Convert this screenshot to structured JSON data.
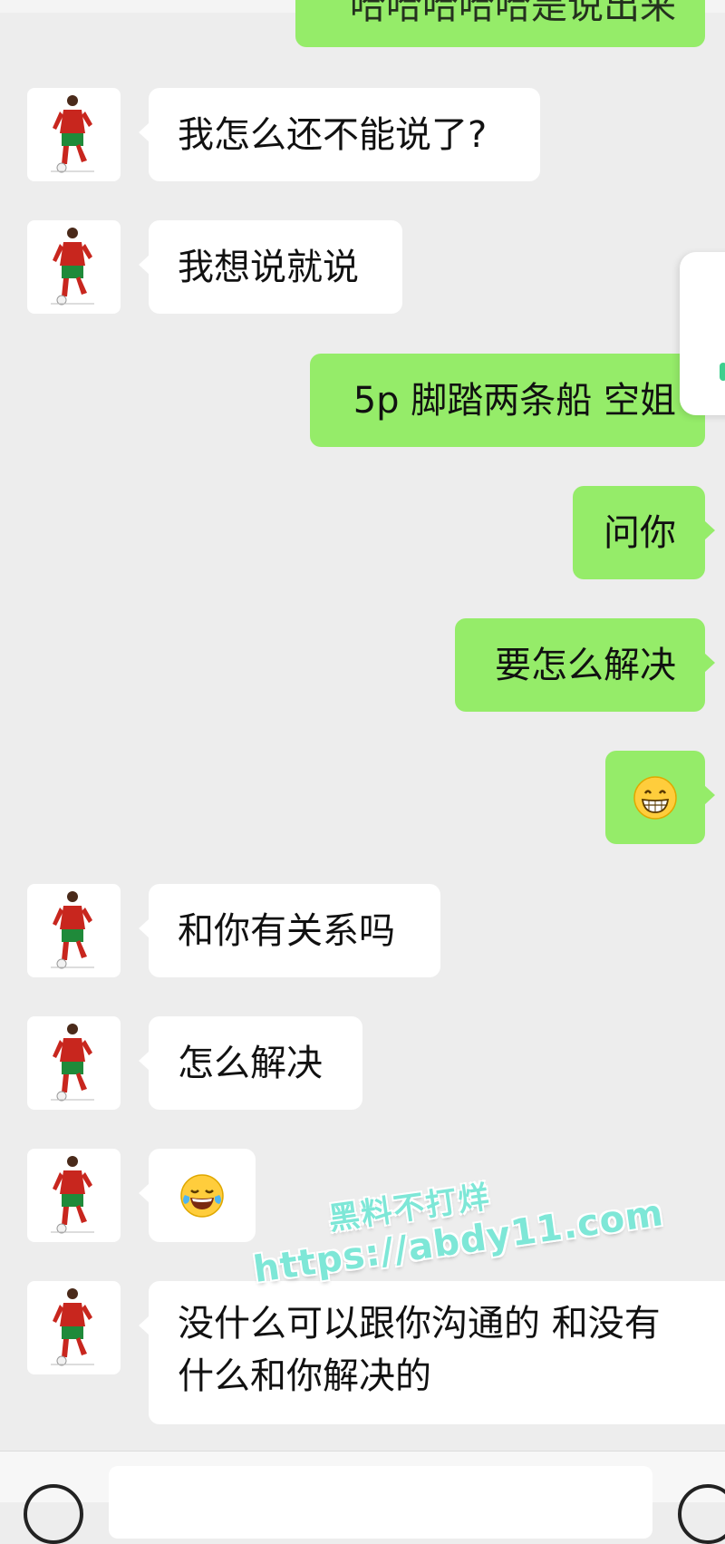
{
  "colors": {
    "background": "#ededed",
    "incoming_bubble": "#ffffff",
    "outgoing_bubble": "#95ec69",
    "watermark": "#7ee7d7"
  },
  "messages": [
    {
      "direction": "out",
      "text": "哈哈哈哈哈是说出来",
      "partial": true
    },
    {
      "direction": "in",
      "text": "我怎么还不能说了?"
    },
    {
      "direction": "in",
      "text": "我想说就说"
    },
    {
      "direction": "out",
      "text": "5p 脚踏两条船 空姐"
    },
    {
      "direction": "out",
      "text": "问你"
    },
    {
      "direction": "out",
      "text": "要怎么解决"
    },
    {
      "direction": "out",
      "emoji": "grinning-face-emoji",
      "text": "😁"
    },
    {
      "direction": "in",
      "text": "和你有关系吗"
    },
    {
      "direction": "in",
      "text": "怎么解决"
    },
    {
      "direction": "in",
      "emoji": "tears-of-joy-emoji",
      "text": "😂"
    },
    {
      "direction": "in",
      "text": "没什么可以跟你沟通的 和没有什么和你解决的"
    }
  ],
  "watermark": {
    "line1": "黑料不打烊",
    "line2": "https://abdy11.com"
  },
  "icons": {
    "avatar": "soccer-player-avatar",
    "voice": "voice-icon",
    "emoji_button": "emoji-icon"
  }
}
